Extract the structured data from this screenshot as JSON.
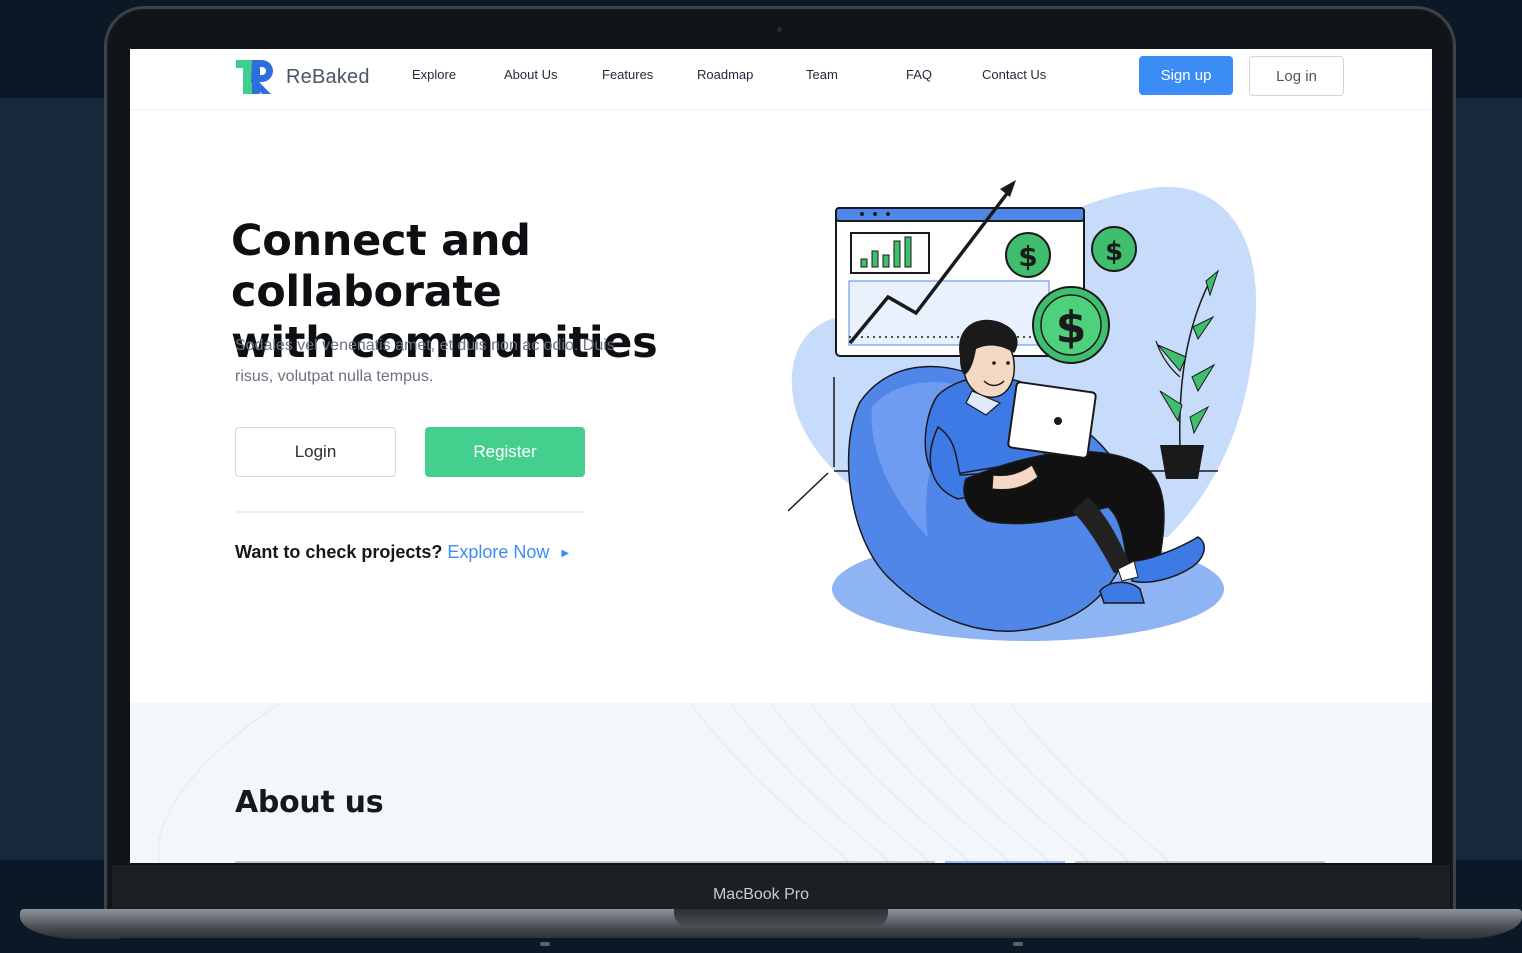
{
  "device": {
    "label": "MacBook Pro"
  },
  "nav": {
    "logo_text": "ReBaked",
    "links": [
      "Explore",
      "About Us",
      "Features",
      "Roadmap",
      "Team",
      "FAQ",
      "Contact Us"
    ],
    "signup_label": "Sign up",
    "login_label": "Log in"
  },
  "hero": {
    "title_line1": "Connect and collaborate",
    "title_line2": "with communities",
    "subtitle_line1": "Sodales vel venenatis amet, et duis non ac odio. Duis",
    "subtitle_line2": "risus, volutpat nulla tempus.",
    "login_label": "Login",
    "register_label": "Register",
    "explore_question": "Want to check projects?",
    "explore_link": "Explore Now"
  },
  "about": {
    "title": "About us"
  },
  "colors": {
    "brand_blue": "#3b8cf5",
    "brand_green": "#45cf8f",
    "illustration_blue": "#4f86e8",
    "illustration_light": "#c7dbfb",
    "coin_green": "#3fbf6d"
  },
  "icons": {
    "logo": "rebaked-r-logo",
    "explore_arrow": "caret-right-icon"
  }
}
